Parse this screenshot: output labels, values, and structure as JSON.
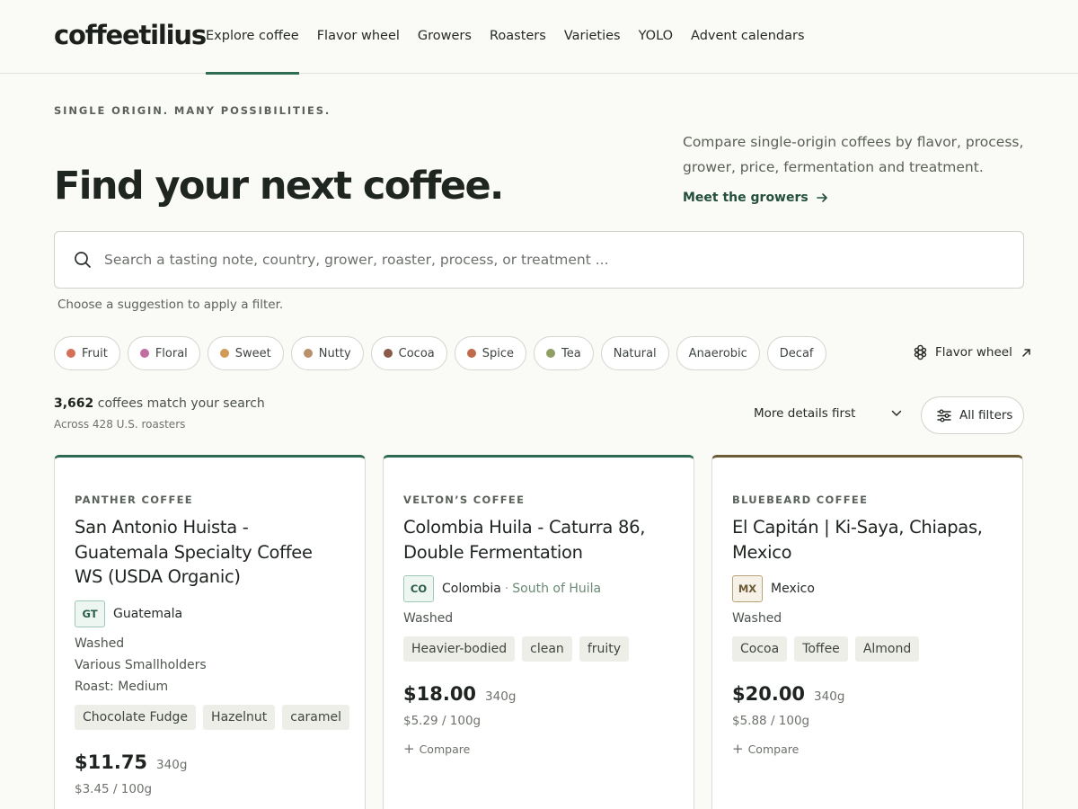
{
  "header": {
    "logo": "coffeetilius",
    "nav": [
      "Explore coffee",
      "Flavor wheel",
      "Growers",
      "Roasters",
      "Varieties",
      "YOLO",
      "Advent calendars"
    ]
  },
  "hero": {
    "eyebrow": "SINGLE ORIGIN. MANY POSSIBILITIES.",
    "title": "Find your next coffee.",
    "description": "Compare single-origin coffees by flavor, process, grower, price, fermentation and treatment.",
    "link": "Meet the growers"
  },
  "search": {
    "placeholder": "Search a tasting note, country, grower, roaster, process, or treatment ...",
    "hint": "Choose a suggestion to apply a filter."
  },
  "chips": [
    {
      "label": "Fruit",
      "color": "#d4705a"
    },
    {
      "label": "Floral",
      "color": "#c06fa0"
    },
    {
      "label": "Sweet",
      "color": "#d19a56"
    },
    {
      "label": "Nutty",
      "color": "#b8916a"
    },
    {
      "label": "Cocoa",
      "color": "#8a5a4a"
    },
    {
      "label": "Spice",
      "color": "#c06a4c"
    },
    {
      "label": "Tea",
      "color": "#8f9e62"
    },
    {
      "label": "Natural"
    },
    {
      "label": "Anaerobic"
    },
    {
      "label": "Decaf"
    }
  ],
  "flavor_wheel_link": "Flavor wheel",
  "results": {
    "count": "3,662",
    "count_suffix": "coffees match your search",
    "subtext": "Across 428 U.S. roasters",
    "sort_label": "More details first",
    "filters_label": "All filters"
  },
  "cards": [
    {
      "roaster": "PANTHER COFFEE",
      "name": "San Antonio Huista - Guatemala Specialty Coffee WS (USDA Organic)",
      "country_code": "GT",
      "country": "Guatemala",
      "process": "Washed",
      "producer": "Various Smallholders",
      "roast": "Roast: Medium",
      "notes": [
        "Chocolate Fudge",
        "Hazelnut",
        "caramel"
      ],
      "price": "$11.75",
      "size": "340g",
      "per_100g": "$3.45 / 100g"
    },
    {
      "roaster": "VELTON’S COFFEE",
      "name": "Colombia Huila - Caturra 86, Double Fermentation",
      "country_code": "CO",
      "country": "Colombia",
      "region": "South of Huila",
      "process": "Washed",
      "notes": [
        "Heavier-bodied",
        "clean",
        "fruity"
      ],
      "price": "$18.00",
      "size": "340g",
      "per_100g": "$5.29 / 100g",
      "compare": "Compare"
    },
    {
      "roaster": "BLUEBEARD COFFEE",
      "name": "El Capitán | Ki-Saya, Chiapas, Mexico",
      "country_code": "MX",
      "country": "Mexico",
      "process": "Washed",
      "notes": [
        "Cocoa",
        "Toffee",
        "Almond"
      ],
      "price": "$20.00",
      "size": "340g",
      "per_100g": "$5.88 / 100g",
      "compare": "Compare"
    }
  ],
  "icons": {
    "search": "search-icon",
    "arrow": "arrow-right-icon",
    "flavor_wheel": "flower-icon",
    "external": "arrow-up-right-icon",
    "sort": "chevron-down-icon",
    "filters": "sliders-icon",
    "compare": "plus-icon"
  }
}
